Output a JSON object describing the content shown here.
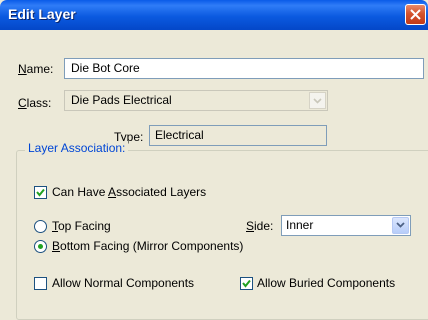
{
  "window": {
    "title": "Edit Layer"
  },
  "name": {
    "label_pre": "",
    "label_mnemonic": "N",
    "label_post": "ame:",
    "value": "Die Bot Core"
  },
  "class": {
    "label_mnemonic": "C",
    "label_post": "lass:",
    "value": "Die Pads Electrical"
  },
  "type": {
    "label": "Type:",
    "value": "Electrical"
  },
  "layer_association": {
    "title": "Layer Association:",
    "can_have": {
      "pre": "Can Have ",
      "mnemonic": "A",
      "post": "ssociated Layers",
      "checked": true
    },
    "top_facing": {
      "pre": "",
      "mnemonic": "T",
      "post": "op Facing",
      "selected": false
    },
    "bottom_facing": {
      "pre": "",
      "mnemonic": "B",
      "post": "ottom Facing (Mirror Components)",
      "selected": true
    },
    "side": {
      "mnemonic": "S",
      "post": "ide:",
      "value": "Inner"
    },
    "allow_normal": {
      "label": "Allow Normal Components",
      "checked": false
    },
    "allow_buried": {
      "label": "Allow Buried Components",
      "checked": true
    }
  },
  "colors": {
    "titlebar": "#0b5ae0",
    "group_title": "#0046d5",
    "radio_dot": "#21a121",
    "check": "#21a121"
  }
}
